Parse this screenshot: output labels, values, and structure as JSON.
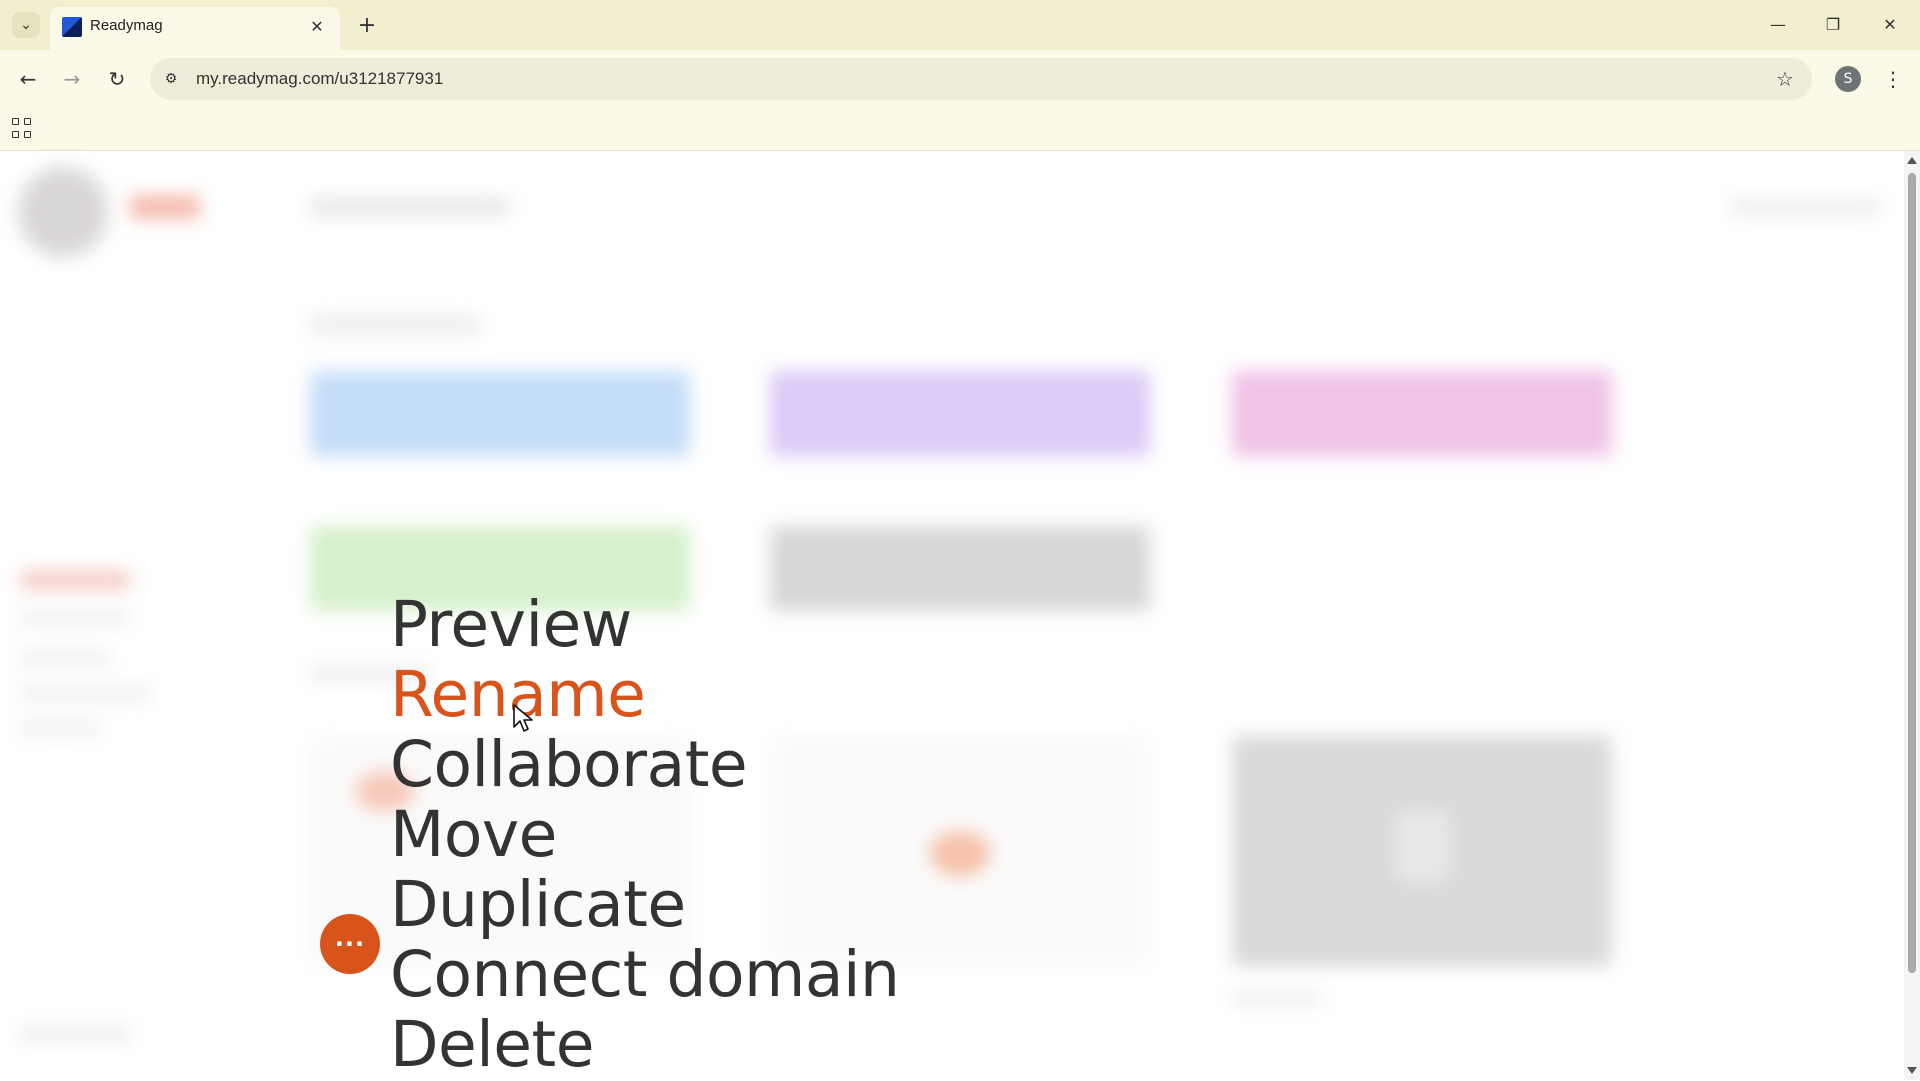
{
  "browser": {
    "tab_title": "Readymag",
    "url": "my.readymag.com/u3121877931",
    "profile_initial": "S"
  },
  "context_menu": {
    "items": [
      {
        "label": "Preview"
      },
      {
        "label": "Rename",
        "active": true
      },
      {
        "label": "Collaborate"
      },
      {
        "label": "Move"
      },
      {
        "label": "Duplicate"
      },
      {
        "label": "Connect domain"
      },
      {
        "label": "Delete"
      }
    ],
    "more_button_label": "···"
  },
  "colors": {
    "accent": "#d8541b",
    "chrome_bg": "#f2efd0",
    "menu_text": "#333333"
  },
  "icons": {
    "tab_search": "chevron-down-icon",
    "favicon": "readymag-favicon",
    "close": "close-icon",
    "new_tab": "plus-icon",
    "back": "back-arrow-icon",
    "forward": "forward-arrow-icon",
    "reload": "reload-icon",
    "site_info": "tune-icon",
    "bookmark": "star-icon",
    "menu": "kebab-icon",
    "apps": "apps-grid-icon",
    "cursor": "mouse-pointer-icon"
  }
}
